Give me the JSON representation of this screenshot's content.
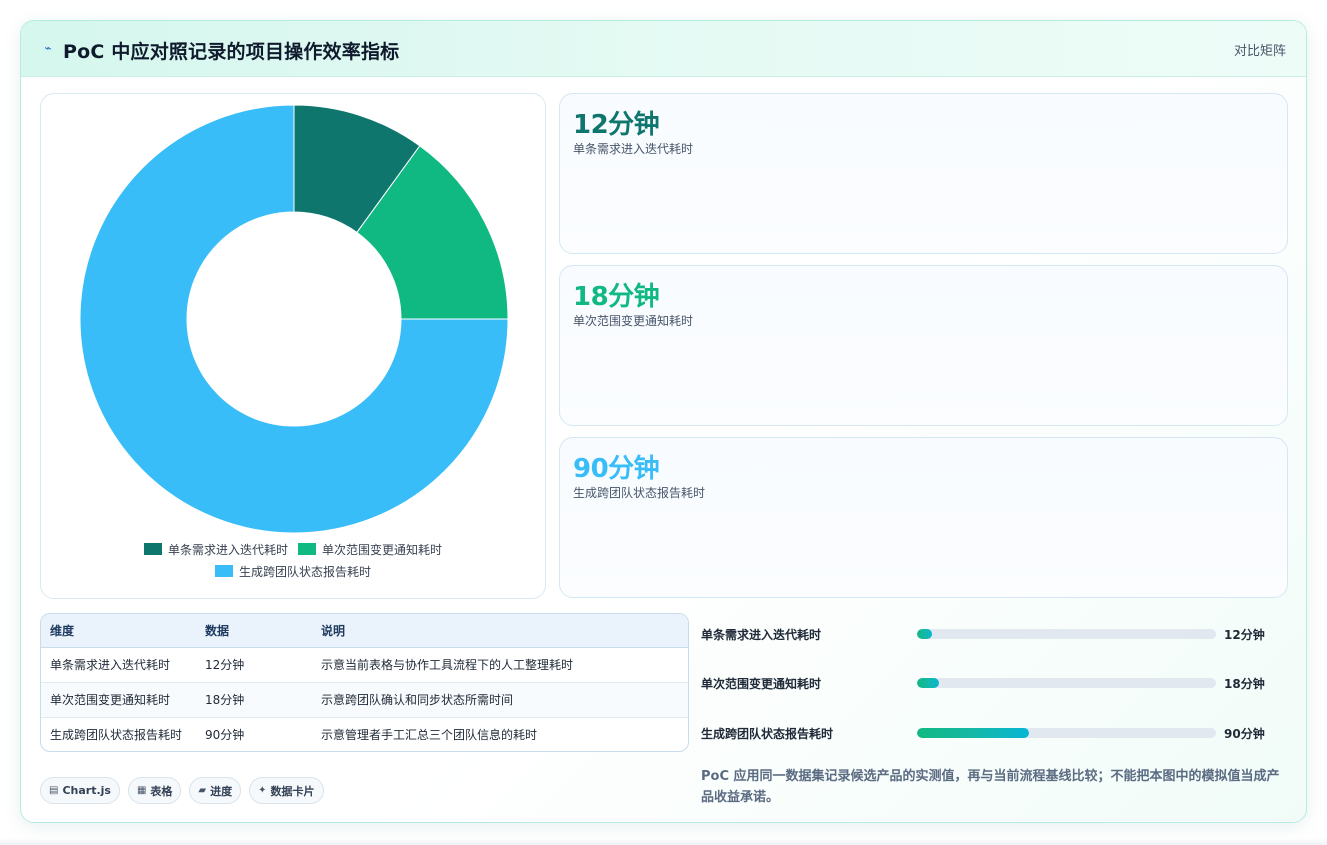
{
  "header": {
    "icon": "bolt-icon",
    "title": "PoC 中应对照记录的项目操作效率指标",
    "right_label": "对比矩阵"
  },
  "colors": {
    "dark_teal": "#0f766e",
    "green": "#10b981",
    "sky": "#38bdf8"
  },
  "chart_data": {
    "type": "pie",
    "categories": [
      "单条需求进入迭代耗时",
      "单次范围变更通知耗时",
      "生成跨团队状态报告耗时"
    ],
    "values": [
      12,
      18,
      90
    ],
    "unit": "分钟",
    "colors": [
      "#0f766e",
      "#10b981",
      "#38bdf8"
    ],
    "donut": true,
    "legend_position": "bottom"
  },
  "stats": [
    {
      "value": "12分钟",
      "label": "单条需求进入迭代耗时",
      "color": "#0f766e"
    },
    {
      "value": "18分钟",
      "label": "单次范围变更通知耗时",
      "color": "#10b981"
    },
    {
      "value": "90分钟",
      "label": "生成跨团队状态报告耗时",
      "color": "#38bdf8"
    }
  ],
  "table": {
    "headers": [
      "维度",
      "数据",
      "说明"
    ],
    "rows": [
      [
        "单条需求进入迭代耗时",
        "12分钟",
        "示意当前表格与协作工具流程下的人工整理耗时"
      ],
      [
        "单次范围变更通知耗时",
        "18分钟",
        "示意跨团队确认和同步状态所需时间"
      ],
      [
        "生成跨团队状态报告耗时",
        "90分钟",
        "示意管理者手工汇总三个团队信息的耗时"
      ]
    ]
  },
  "progress": {
    "max": 240,
    "items": [
      {
        "label": "单条需求进入迭代耗时",
        "value": 12,
        "display": "12分钟"
      },
      {
        "label": "单次范围变更通知耗时",
        "value": 18,
        "display": "18分钟"
      },
      {
        "label": "生成跨团队状态报告耗时",
        "value": 90,
        "display": "90分钟"
      }
    ]
  },
  "chips": [
    {
      "icon": "chart-icon",
      "glyph": "▤",
      "label": "Chart.js"
    },
    {
      "icon": "table-icon",
      "glyph": "▦",
      "label": "表格"
    },
    {
      "icon": "progress-icon",
      "glyph": "▰",
      "label": "进度"
    },
    {
      "icon": "sparkle-icon",
      "glyph": "✦",
      "label": "数据卡片"
    }
  ],
  "note": "PoC 应用同一数据集记录候选产品的实测值，再与当前流程基线比较；不能把本图中的模拟值当成产品收益承诺。"
}
